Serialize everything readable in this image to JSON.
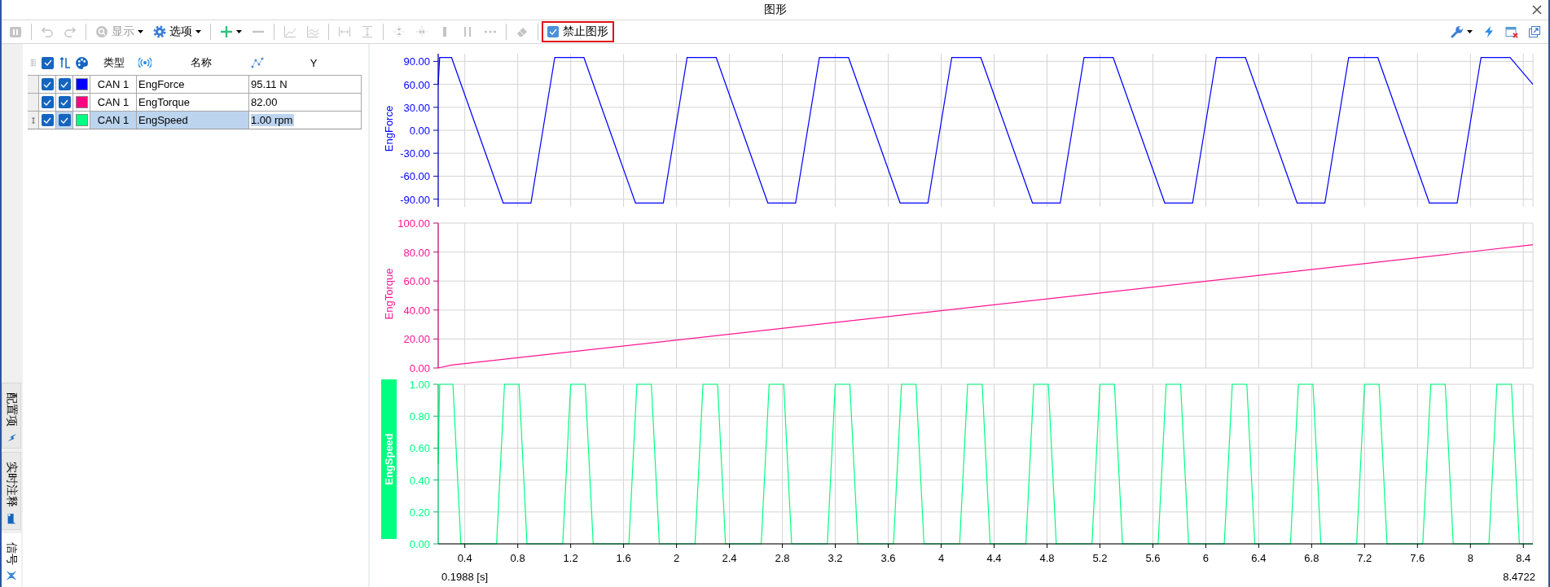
{
  "window": {
    "title": "图形"
  },
  "toolbar": {
    "items": [
      {
        "kind": "button",
        "disabled": true,
        "dropdown": false
      },
      {
        "kind": "separator"
      },
      {
        "kind": "button",
        "disabled": true,
        "dropdown": false
      },
      {
        "kind": "button",
        "disabled": true,
        "dropdown": false
      },
      {
        "kind": "separator"
      },
      {
        "kind": "button",
        "disabled": true,
        "dropdown": true,
        "label": "显示"
      },
      {
        "kind": "button",
        "disabled": false,
        "dropdown": true,
        "label": "选项"
      },
      {
        "kind": "separator"
      },
      {
        "kind": "button",
        "disabled": false,
        "dropdown": true
      },
      {
        "kind": "button",
        "disabled": true,
        "dropdown": false
      },
      {
        "kind": "separator"
      },
      {
        "kind": "button",
        "disabled": true,
        "dropdown": false
      },
      {
        "kind": "button",
        "disabled": true,
        "dropdown": false
      },
      {
        "kind": "separator"
      },
      {
        "kind": "button",
        "disabled": true,
        "dropdown": false
      },
      {
        "kind": "button",
        "disabled": true,
        "dropdown": false
      },
      {
        "kind": "separator"
      },
      {
        "kind": "button",
        "disabled": true,
        "dropdown": false
      },
      {
        "kind": "button",
        "disabled": true,
        "dropdown": false
      },
      {
        "kind": "button",
        "disabled": true,
        "dropdown": false
      },
      {
        "kind": "button",
        "disabled": true,
        "dropdown": false
      },
      {
        "kind": "button",
        "disabled": true,
        "dropdown": false
      },
      {
        "kind": "separator"
      },
      {
        "kind": "button",
        "disabled": true,
        "dropdown": false
      },
      {
        "kind": "separator"
      },
      {
        "kind": "checkbox",
        "label": "禁止图形",
        "checked": true,
        "highlighted": true
      }
    ],
    "right_items": [
      {
        "kind": "button",
        "disabled": false,
        "dropdown": true
      },
      {
        "kind": "button",
        "disabled": false,
        "dropdown": false
      },
      {
        "kind": "button",
        "disabled": false,
        "dropdown": false
      },
      {
        "kind": "button",
        "disabled": false,
        "dropdown": false
      }
    ]
  },
  "side_tabs": [
    {
      "label": "配置项",
      "selected": false
    },
    {
      "label": "实时注释",
      "selected": false
    },
    {
      "label": "信号",
      "selected": true
    }
  ],
  "signal_table": {
    "header_checked": true,
    "columns": [
      {
        "label": "类型"
      },
      {
        "label": "名称"
      },
      {
        "label": "Y"
      }
    ],
    "rows": [
      {
        "checked": true,
        "enabled": true,
        "color": "#0000ff",
        "type": "CAN 1",
        "name": "EngForce",
        "value": "95.11 N",
        "selected": false
      },
      {
        "checked": true,
        "enabled": true,
        "color": "#ff0080",
        "type": "CAN 1",
        "name": "EngTorque",
        "value": "82.00",
        "selected": false
      },
      {
        "checked": true,
        "enabled": true,
        "color": "#00ff80",
        "type": "CAN 1",
        "name": "EngSpeed",
        "value": "1.00 rpm",
        "selected": true
      }
    ]
  },
  "chart_panes": [
    {
      "selected": false,
      "chart_data": {
        "type": "line",
        "grid": true,
        "xlim": [
          0.1988,
          8.4722
        ],
        "ylim": [
          -100,
          100
        ],
        "yticks": [
          {
            "value": 90,
            "label": "90.00"
          },
          {
            "value": 60,
            "label": "60.00"
          },
          {
            "value": 30,
            "label": "30.00"
          },
          {
            "value": 0,
            "label": "0.00"
          },
          {
            "value": -30,
            "label": "-30.00"
          },
          {
            "value": -60,
            "label": "-60.00"
          },
          {
            "value": -90,
            "label": "-90.00"
          }
        ],
        "x": [
          0.1988,
          0.21,
          0.3,
          0.69,
          0.9,
          1.08,
          1.3,
          1.69,
          1.9,
          2.08,
          2.3,
          2.69,
          2.9,
          3.08,
          3.3,
          3.69,
          3.9,
          4.08,
          4.3,
          4.69,
          4.9,
          5.08,
          5.3,
          5.69,
          5.9,
          6.08,
          6.3,
          6.69,
          6.9,
          7.08,
          7.3,
          7.69,
          7.9,
          8.08,
          8.3,
          8.4722
        ],
        "series": [
          {
            "name": "EngForce",
            "color": "#0000ff",
            "values": [
              60,
              95,
              95,
              -95,
              -95,
              95,
              95,
              -95,
              -95,
              95,
              95,
              -95,
              -95,
              95,
              95,
              -95,
              -95,
              95,
              95,
              -95,
              -95,
              95,
              95,
              -95,
              -95,
              95,
              95,
              -95,
              -95,
              95,
              95,
              -95,
              -95,
              95,
              95,
              60
            ]
          }
        ]
      }
    },
    {
      "selected": false,
      "chart_data": {
        "type": "line",
        "grid": true,
        "xlim": [
          0.1988,
          8.4722
        ],
        "ylim": [
          0,
          100
        ],
        "yticks": [
          {
            "value": 100,
            "label": "100.00"
          },
          {
            "value": 80,
            "label": "80.00"
          },
          {
            "value": 60,
            "label": "60.00"
          },
          {
            "value": 40,
            "label": "40.00"
          },
          {
            "value": 20,
            "label": "20.00"
          },
          {
            "value": 0,
            "label": "0.00"
          }
        ],
        "x": [
          0.1988,
          0.3,
          8.4722
        ],
        "series": [
          {
            "name": "EngTorque",
            "color": "#ff1493",
            "values": [
              0,
              2,
              85
            ]
          }
        ]
      }
    },
    {
      "selected": true,
      "chart_data": {
        "type": "line",
        "grid": true,
        "xlim": [
          0.1988,
          8.4722
        ],
        "ylim": [
          0,
          1
        ],
        "yticks": [
          {
            "value": 1,
            "label": "1.00"
          },
          {
            "value": 0.8,
            "label": "0.80"
          },
          {
            "value": 0.6,
            "label": "0.60"
          },
          {
            "value": 0.4,
            "label": "0.40"
          },
          {
            "value": 0.2,
            "label": "0.20"
          },
          {
            "value": 0,
            "label": "0.00"
          }
        ],
        "xticks": [
          0.4,
          0.8,
          1.2,
          1.6,
          2,
          2.4,
          2.8,
          3.2,
          3.6,
          4,
          4.4,
          4.8,
          5.2,
          5.6,
          6,
          6.4,
          6.8,
          7.2,
          7.6,
          8,
          8.4
        ],
        "x": [
          0.1988,
          0.21,
          0.31,
          0.37,
          0.64,
          0.7,
          0.81,
          0.87,
          1.14,
          1.2,
          1.31,
          1.37,
          1.64,
          1.7,
          1.81,
          1.87,
          2.14,
          2.2,
          2.31,
          2.37,
          2.64,
          2.7,
          2.81,
          2.87,
          3.14,
          3.2,
          3.31,
          3.37,
          3.64,
          3.7,
          3.81,
          3.87,
          4.14,
          4.2,
          4.31,
          4.37,
          4.64,
          4.7,
          4.81,
          4.87,
          5.14,
          5.2,
          5.31,
          5.37,
          5.64,
          5.7,
          5.81,
          5.87,
          6.14,
          6.2,
          6.31,
          6.37,
          6.64,
          6.7,
          6.81,
          6.87,
          7.14,
          7.2,
          7.31,
          7.37,
          7.64,
          7.7,
          7.81,
          7.87,
          8.14,
          8.2,
          8.31,
          8.37,
          8.4722
        ],
        "series": [
          {
            "name": "EngSpeed",
            "color": "#00ff80",
            "values": [
              0.5,
              1,
              1,
              0,
              0,
              1,
              1,
              0,
              0,
              1,
              1,
              0,
              0,
              1,
              1,
              0,
              0,
              1,
              1,
              0,
              0,
              1,
              1,
              0,
              0,
              1,
              1,
              0,
              0,
              1,
              1,
              0,
              0,
              1,
              1,
              0,
              0,
              1,
              1,
              0,
              0,
              1,
              1,
              0,
              0,
              1,
              1,
              0,
              0,
              1,
              1,
              0,
              0,
              1,
              1,
              0,
              0,
              1,
              1,
              0,
              0,
              1,
              1,
              0,
              0,
              1,
              1,
              0,
              0
            ]
          }
        ]
      }
    }
  ],
  "x_axis": {
    "start_label": "0.1988 [s]",
    "end_label": "8.4722"
  }
}
